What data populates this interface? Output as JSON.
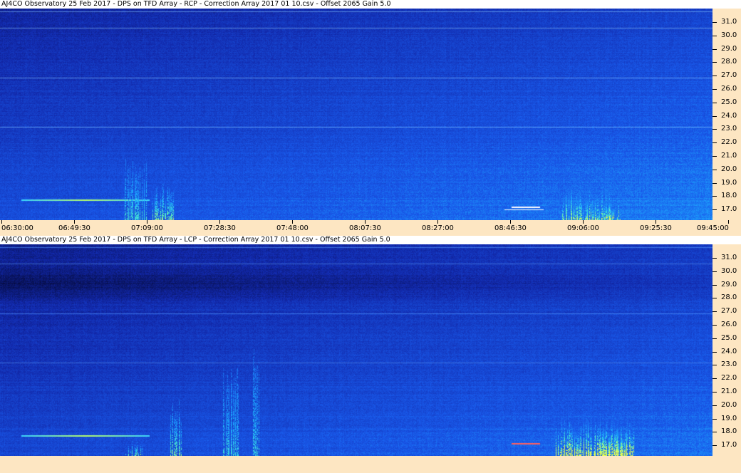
{
  "panels": [
    {
      "title": "AJ4CO Observatory 25 Feb 2017  -  DPS on TFD Array  -  RCP  -  Correction Array 2017 01 10.csv  -  Offset 2065  Gain 5.0",
      "polarization": "RCP"
    },
    {
      "title": "AJ4CO Observatory 25 Feb 2017  -  DPS on TFD Array  -  LCP  -  Correction Array 2017 01 10.csv  -  Offset 2065  Gain 5.0",
      "polarization": "LCP"
    }
  ],
  "freq_labels": [
    "31.0",
    "30.0",
    "29.0",
    "28.0",
    "27.0",
    "26.0",
    "25.0",
    "24.0",
    "23.0",
    "22.0",
    "21.0",
    "20.0",
    "19.0",
    "18.0",
    "17.0"
  ],
  "time_labels": [
    "06:30:00",
    "06:49:30",
    "07:09:00",
    "07:28:30",
    "07:48:00",
    "08:07:30",
    "08:27:00",
    "08:46:30",
    "09:06:00",
    "09:25:30",
    "09:45:00"
  ],
  "colors": {
    "axis_background": "#fde6c2",
    "title_background": "#ffffff",
    "colormap_low": "#08104a",
    "colormap_mid": "#1a4fd8",
    "colormap_high": "#2fd0ff",
    "burst_color": "#9cff4a"
  }
}
